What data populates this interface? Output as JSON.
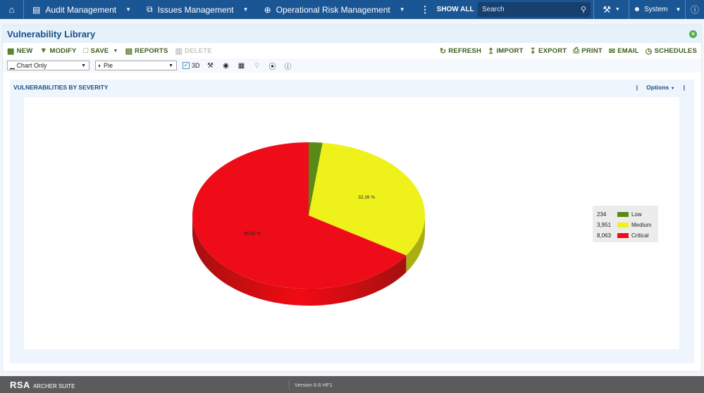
{
  "topnav": {
    "home_icon": "home-icon",
    "items": [
      {
        "label": "Audit Management",
        "icon": "book-icon"
      },
      {
        "label": "Issues Management",
        "icon": "ticket-icon"
      },
      {
        "label": "Operational Risk Management",
        "icon": "crosshair-icon"
      }
    ],
    "show_all": "SHOW ALL",
    "search_placeholder": "Search",
    "user": "System"
  },
  "panel": {
    "title": "Vulnerability Library",
    "toolbar_left": [
      {
        "label": "NEW",
        "icon": "new-record-icon",
        "enabled": true
      },
      {
        "label": "MODIFY",
        "icon": "filter-icon",
        "enabled": true
      },
      {
        "label": "SAVE",
        "icon": "save-icon",
        "enabled": true
      },
      {
        "label": "REPORTS",
        "icon": "reports-icon",
        "enabled": true
      },
      {
        "label": "DELETE",
        "icon": "trash-icon",
        "enabled": false
      }
    ],
    "toolbar_right": [
      {
        "label": "REFRESH",
        "icon": "refresh-icon"
      },
      {
        "label": "IMPORT",
        "icon": "import-icon"
      },
      {
        "label": "EXPORT",
        "icon": "export-icon"
      },
      {
        "label": "PRINT",
        "icon": "print-icon"
      },
      {
        "label": "EMAIL",
        "icon": "email-icon"
      },
      {
        "label": "SCHEDULES",
        "icon": "clock-icon"
      }
    ],
    "display_mode": "Chart Only",
    "chart_type": "Pie",
    "three_d_label": "3D",
    "three_d_checked": true
  },
  "chart_panel": {
    "title": "VULNERABILITIES BY SEVERITY",
    "options_label": "Options"
  },
  "chart_data": {
    "type": "pie",
    "title": "VULNERABILITIES BY SEVERITY",
    "three_d": true,
    "categories": [
      "Low",
      "Medium",
      "Critical"
    ],
    "values": [
      234,
      3951,
      8063
    ],
    "value_labels": [
      "234",
      "3,951",
      "8,063"
    ],
    "percent_labels": [
      "",
      "32.26 %",
      "65.83 %"
    ],
    "colors": [
      "#5a8a16",
      "#eef21a",
      "#ee0c18"
    ],
    "legend_position": "right"
  },
  "footer": {
    "brand": "RSA",
    "suite": "ARCHER SUITE",
    "version": "Version 6.6 HF1"
  }
}
